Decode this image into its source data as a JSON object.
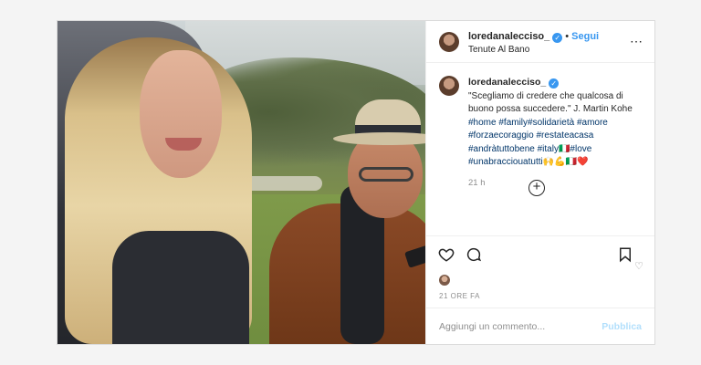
{
  "post": {
    "username": "loredanalecciso_",
    "separator": "•",
    "follow_label": "Segui",
    "location": "Tenute Al Bano",
    "more_icon": "⋯",
    "verified_icon": "✓",
    "caption": {
      "username": "loredanalecciso_",
      "text": "\"Scegliamo di credere che qualcosa di buono possa succedere.\" J. Martin Kohe",
      "hashtags": "#home #family#solidarietà #amore #forzaecoraggio #restateacasa #andràtuttobene #italy🇮🇹#love #unabracciouatutti🙌💪🇮🇹❤️",
      "time": "21 h"
    },
    "load_more_icon": "+",
    "mini_heart_icon": "♡",
    "timestamp": "21 ORE FA",
    "comment_placeholder": "Aggiungi un commento...",
    "publish_label": "Pubblica",
    "colors": {
      "accent": "#3897f0",
      "publish_disabled": "#b2dffc",
      "hashtag": "#003569"
    }
  }
}
